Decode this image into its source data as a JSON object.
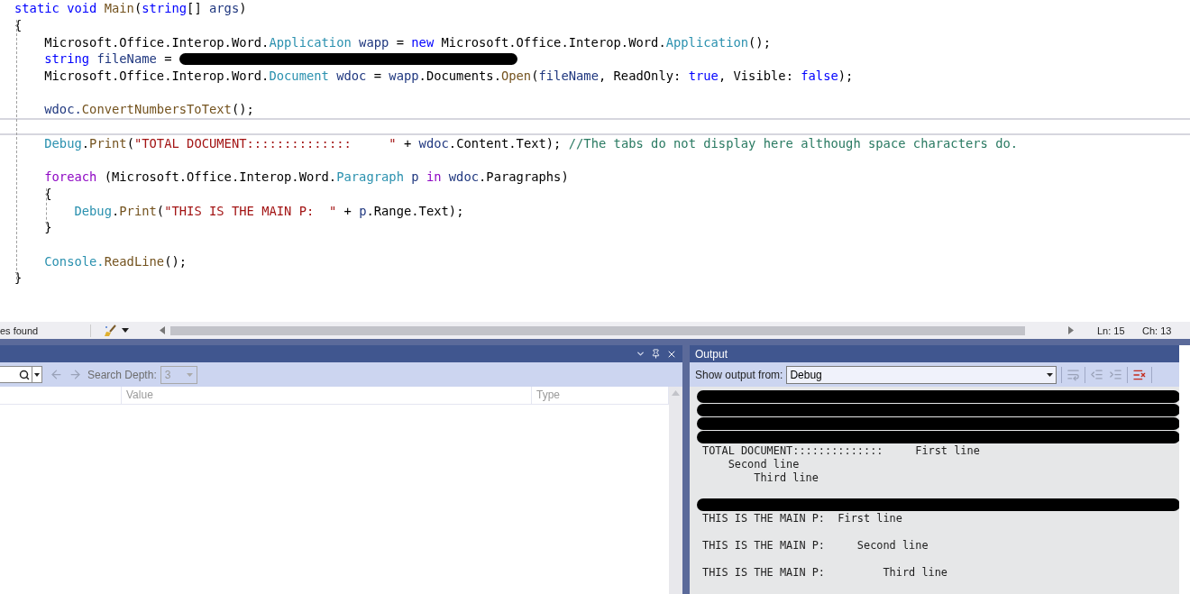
{
  "editor": {
    "lines": [
      {
        "current": false,
        "tokens": [
          {
            "kind": "keyword",
            "text": "static void "
          },
          {
            "kind": "method",
            "text": "Main"
          },
          {
            "kind": "plain",
            "text": "("
          },
          {
            "kind": "keyword",
            "text": "string"
          },
          {
            "kind": "plain",
            "text": "[] "
          },
          {
            "kind": "local",
            "text": "args"
          },
          {
            "kind": "plain",
            "text": ")"
          }
        ]
      },
      {
        "current": false,
        "tokens": [
          {
            "kind": "plain",
            "text": "{"
          }
        ]
      },
      {
        "current": false,
        "tokens": [
          {
            "kind": "plain",
            "text": "    Microsoft.Office.Interop.Word."
          },
          {
            "kind": "type",
            "text": "Application"
          },
          {
            "kind": "local",
            "text": " wapp"
          },
          {
            "kind": "plain",
            "text": " = "
          },
          {
            "kind": "keyword",
            "text": "new"
          },
          {
            "kind": "plain",
            "text": " Microsoft.Office.Interop.Word."
          },
          {
            "kind": "type",
            "text": "Application"
          },
          {
            "kind": "plain",
            "text": "();"
          }
        ]
      },
      {
        "current": false,
        "tokens": [
          {
            "kind": "keyword",
            "text": "    string"
          },
          {
            "kind": "local",
            "text": " fileName"
          },
          {
            "kind": "plain",
            "text": " = "
          },
          {
            "kind": "redacted"
          }
        ]
      },
      {
        "current": false,
        "tokens": [
          {
            "kind": "plain",
            "text": "    Microsoft.Office.Interop.Word."
          },
          {
            "kind": "type",
            "text": "Document"
          },
          {
            "kind": "local",
            "text": " wdoc"
          },
          {
            "kind": "plain",
            "text": " = "
          },
          {
            "kind": "local",
            "text": "wapp"
          },
          {
            "kind": "plain",
            "text": ".Documents."
          },
          {
            "kind": "method",
            "text": "Open"
          },
          {
            "kind": "plain",
            "text": "("
          },
          {
            "kind": "local",
            "text": "fileName"
          },
          {
            "kind": "plain",
            "text": ", ReadOnly: "
          },
          {
            "kind": "keyword",
            "text": "true"
          },
          {
            "kind": "plain",
            "text": ", Visible: "
          },
          {
            "kind": "keyword",
            "text": "false"
          },
          {
            "kind": "plain",
            "text": ");"
          }
        ]
      },
      {
        "current": false
      },
      {
        "current": false,
        "tokens": [
          {
            "kind": "local",
            "text": "    wdoc."
          },
          {
            "kind": "method",
            "text": "ConvertNumbersToText"
          },
          {
            "kind": "plain",
            "text": "();"
          }
        ]
      },
      {
        "current": true
      },
      {
        "current": false,
        "tokens": [
          {
            "kind": "type",
            "text": "    Debug"
          },
          {
            "kind": "plain",
            "text": "."
          },
          {
            "kind": "method",
            "text": "Print"
          },
          {
            "kind": "plain",
            "text": "("
          },
          {
            "kind": "string",
            "text": "\"TOTAL DOCUMENT::::::::::::::     \""
          },
          {
            "kind": "plain",
            "text": " + "
          },
          {
            "kind": "local",
            "text": "wdoc"
          },
          {
            "kind": "plain",
            "text": ".Content.Text); "
          },
          {
            "kind": "comment",
            "text": "//The tabs do not display here although space characters do."
          }
        ]
      },
      {
        "current": false
      },
      {
        "current": false,
        "tokens": [
          {
            "kind": "control",
            "text": "    foreach"
          },
          {
            "kind": "plain",
            "text": " (Microsoft.Office.Interop.Word."
          },
          {
            "kind": "type",
            "text": "Paragraph"
          },
          {
            "kind": "local",
            "text": " p"
          },
          {
            "kind": "control",
            "text": " in"
          },
          {
            "kind": "local",
            "text": " wdoc"
          },
          {
            "kind": "plain",
            "text": ".Paragraphs)"
          }
        ]
      },
      {
        "current": false,
        "tokens": [
          {
            "kind": "plain",
            "text": "    {"
          }
        ]
      },
      {
        "current": false,
        "tokens": [
          {
            "kind": "type",
            "text": "        Debug"
          },
          {
            "kind": "plain",
            "text": "."
          },
          {
            "kind": "method",
            "text": "Print"
          },
          {
            "kind": "plain",
            "text": "("
          },
          {
            "kind": "string",
            "text": "\"THIS IS THE MAIN P:  \""
          },
          {
            "kind": "plain",
            "text": " + "
          },
          {
            "kind": "local",
            "text": "p"
          },
          {
            "kind": "plain",
            "text": ".Range.Text);"
          }
        ]
      },
      {
        "current": false,
        "tokens": [
          {
            "kind": "plain",
            "text": "    }"
          }
        ]
      },
      {
        "current": false
      },
      {
        "current": false,
        "tokens": [
          {
            "kind": "type",
            "text": "    Console."
          },
          {
            "kind": "method",
            "text": "ReadLine"
          },
          {
            "kind": "plain",
            "text": "();"
          }
        ]
      },
      {
        "current": false,
        "tokens": [
          {
            "kind": "plain",
            "text": "}"
          }
        ]
      }
    ]
  },
  "status_bar": {
    "message": "es found",
    "line": "Ln: 15",
    "column": "Ch: 13"
  },
  "locals_panel": {
    "search_depth_label": "Search Depth:",
    "search_depth": "3",
    "columns": [
      null,
      "Value",
      "Type"
    ]
  },
  "output_panel": {
    "title": "Output",
    "source_label": "Show output from:",
    "source": "Debug",
    "lines": [
      {
        "kind": "redacted"
      },
      {
        "kind": "redacted"
      },
      {
        "kind": "redacted"
      },
      {
        "kind": "redacted"
      },
      {
        "kind": "text",
        "text": "TOTAL DOCUMENT::::::::::::::     First line"
      },
      {
        "kind": "text",
        "text": "    Second line"
      },
      {
        "kind": "text",
        "text": "        Third line"
      },
      {
        "kind": "blank"
      },
      {
        "kind": "redacted"
      },
      {
        "kind": "text",
        "text": "THIS IS THE MAIN P:  First line"
      },
      {
        "kind": "blank"
      },
      {
        "kind": "text",
        "text": "THIS IS THE MAIN P:     Second line"
      },
      {
        "kind": "blank"
      },
      {
        "kind": "text",
        "text": "THIS IS THE MAIN P:         Third line"
      }
    ]
  }
}
